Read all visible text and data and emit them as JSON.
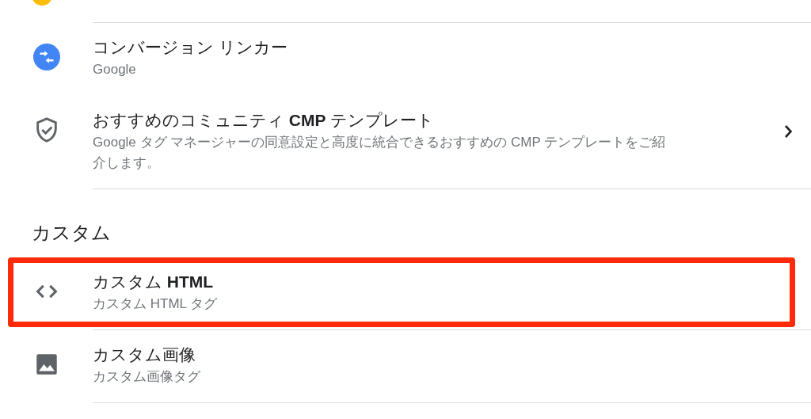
{
  "sections": [
    {
      "items": [
        {
          "title": "コンバージョン リンカー",
          "subtitle": "Google",
          "chevron": false,
          "highlighted": false
        },
        {
          "title": "おすすめのコミュニティ **CMP** テンプレート",
          "subtitle": "Google タグ マネージャーの同意設定と高度に統合できるおすすめの CMP テンプレートをご紹介します。",
          "chevron": true,
          "highlighted": false
        }
      ]
    },
    {
      "heading": "カスタム",
      "items": [
        {
          "title": "カスタム **HTML**",
          "subtitle": "カスタム HTML タグ",
          "chevron": false,
          "highlighted": true
        },
        {
          "title": "カスタム画像",
          "subtitle": "カスタム画像タグ",
          "chevron": false,
          "highlighted": false
        }
      ]
    }
  ]
}
